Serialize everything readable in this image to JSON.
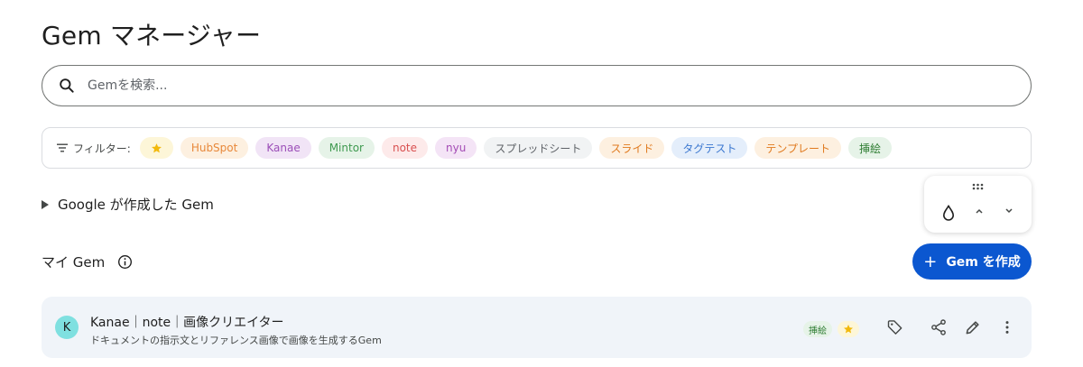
{
  "page": {
    "title": "Gem マネージャー"
  },
  "search": {
    "placeholder": "Gemを検索..."
  },
  "filters": {
    "label": "フィルター:",
    "chips": [
      {
        "label": "",
        "icon": "star-icon",
        "bg": "#fdf6d8",
        "fg": "#e8b400"
      },
      {
        "label": "HubSpot",
        "bg": "#fdf0e0",
        "fg": "#e8883a"
      },
      {
        "label": "Kanae",
        "bg": "#f1e4f6",
        "fg": "#9c4fb8"
      },
      {
        "label": "Mintor",
        "bg": "#e6f3e8",
        "fg": "#3f9a50"
      },
      {
        "label": "note",
        "bg": "#fdeaea",
        "fg": "#d95050"
      },
      {
        "label": "nyu",
        "bg": "#f4e4f6",
        "fg": "#a34bb5"
      },
      {
        "label": "スプレッドシート",
        "bg": "#f1f3f4",
        "fg": "#5f6368"
      },
      {
        "label": "スライド",
        "bg": "#fdf0e0",
        "fg": "#e07a1f"
      },
      {
        "label": "タグテスト",
        "bg": "#e4eefb",
        "fg": "#3c78d0"
      },
      {
        "label": "テンプレート",
        "bg": "#fdf0e0",
        "fg": "#e07a1f"
      },
      {
        "label": "挿絵",
        "bg": "#e6f3e8",
        "fg": "#2e7d32"
      }
    ]
  },
  "google_section": {
    "label": "Google が作成した Gem"
  },
  "my_gem": {
    "label": "マイ Gem",
    "create_label": "Gem を作成"
  },
  "gems": [
    {
      "avatar": "K",
      "name": "Kanae｜note｜画像クリエイター",
      "description": "ドキュメントの指示文とリファレンス画像で画像を生成するGem",
      "tag": "挿絵"
    }
  ],
  "colors": {
    "accent": "#0b57d0",
    "card_bg": "#f0f4f9"
  }
}
